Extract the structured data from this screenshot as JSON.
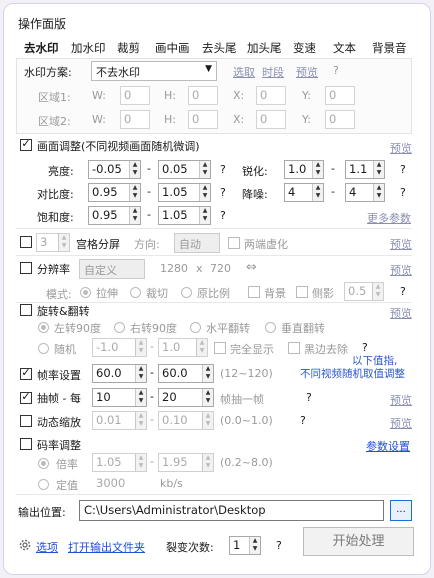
{
  "panel_title": "操作面版",
  "tabs": [
    "去水印",
    "加水印",
    "裁剪",
    "画中画",
    "去头尾",
    "加头尾",
    "变速",
    "文本",
    "背景音"
  ],
  "watermark": {
    "scheme_label": "水印方案:",
    "scheme_value": "不去水印",
    "select_link": "选取",
    "sync_link": "时段",
    "preview_link": "预览",
    "help": "?",
    "region1_label": "区域1:",
    "region2_label": "区域2:",
    "w_label": "W:",
    "h_label": "H:",
    "x_label": "X:",
    "y_label": "Y:",
    "zero": "0"
  },
  "picture": {
    "label": "画面调整(不同视频画面随机微调)",
    "preview": "预览",
    "brightness_label": "亮度:",
    "brightness_min": "-0.05",
    "brightness_max": "0.05",
    "contrast_label": "对比度:",
    "contrast_min": "0.95",
    "contrast_max": "1.05",
    "saturation_label": "饱和度:",
    "saturation_min": "0.95",
    "saturation_max": "1.05",
    "sharpen_label": "锐化:",
    "sharpen_min": "1.0",
    "sharpen_max": "1.1",
    "denoise_label": "降噪:",
    "denoise_min": "4",
    "denoise_max": "4",
    "dash": "-",
    "help": "?",
    "more_link": "更多参数"
  },
  "grid": {
    "count": "3",
    "label": "宫格分屏",
    "direction_label": "方向:",
    "direction_value": "自动",
    "blur_label": "两端虚化",
    "preview": "预览"
  },
  "resolution": {
    "label": "分辨率",
    "preset": "自定义",
    "width": "1280",
    "x": "x",
    "height": "720",
    "swap": "⇔",
    "preview": "预览",
    "mode_label": "模式:",
    "modes": [
      "拉伸",
      "裁切",
      "原比例"
    ],
    "bg_label": "背景",
    "blur_label": "侧影",
    "blur_value": "0.5",
    "help": "?"
  },
  "rotate": {
    "label": "旋转&翻转",
    "preview": "预览",
    "options": [
      "左转90度",
      "右转90度",
      "水平翻转",
      "垂直翻转"
    ],
    "random_label": "随机",
    "random_min": "-1.0",
    "random_max": "1.0",
    "full_label": "完全显示",
    "crop_label": "黑边去除",
    "help": "?"
  },
  "fps": {
    "note_line1": "以下值指,",
    "note_line2": "不同视频随机取值调整",
    "label": "帧率设置",
    "min": "60.0",
    "max": "60.0",
    "range": "(12~120)"
  },
  "extract": {
    "label": "抽帧 - 每",
    "min": "10",
    "max": "20",
    "suffix": "帧抽一帧",
    "help": "?",
    "preview": "预览"
  },
  "zoom": {
    "label": "动态缩放",
    "min": "0.01",
    "max": "0.10",
    "range": "(0.0~1.0)",
    "help": "?",
    "preview": "预览"
  },
  "bitrate": {
    "label": "码率调整",
    "instruction_link": "参数设置",
    "ratio_label": "倍率",
    "ratio_min": "1.05",
    "ratio_max": "1.95",
    "ratio_range": "(0.2~8.0)",
    "fixed_label": "定值",
    "fixed_value": "3000",
    "fixed_unit": "kb/s"
  },
  "output": {
    "label": "输出位置:",
    "path": "C:\\Users\\Administrator\\Desktop",
    "browse": "..."
  },
  "footer": {
    "options_link": "选项",
    "open_folder_link": "打开输出文件夹",
    "repeat_label": "裂变次数:",
    "repeat_value": "1",
    "help": "?",
    "start_button": "开始处理"
  }
}
